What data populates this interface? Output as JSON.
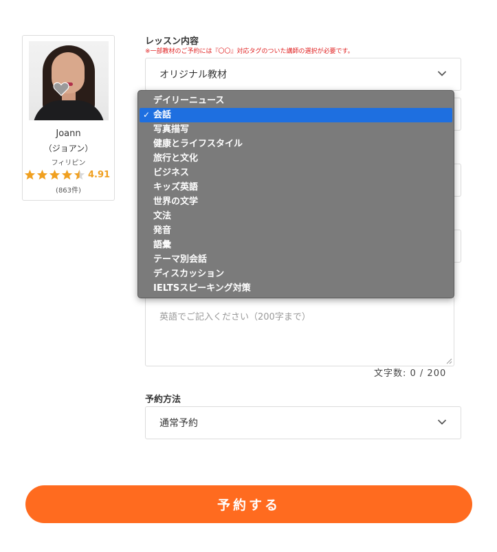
{
  "tutor": {
    "name": "Joann",
    "kana": "（ジョアン）",
    "country": "フィリピン",
    "rating": "4.91",
    "stars": 4.5,
    "reviews": "(863件)"
  },
  "lesson": {
    "label": "レッスン内容",
    "note": "※一部教材のご予約には『〇〇』対応タグのついた講師の選択が必要です。",
    "selected": "オリジナル教材"
  },
  "dropdown": {
    "options": [
      "デイリーニュース",
      "会話",
      "写真描写",
      "健康とライフスタイル",
      "旅行と文化",
      "ビジネス",
      "キッズ英語",
      "世界の文学",
      "文法",
      "発音",
      "語彙",
      "テーマ別会話",
      "ディスカッション",
      "IELTSスピーキング対策"
    ],
    "selected_index": 1,
    "check_mark": "✓"
  },
  "comment": {
    "placeholder": "英語でご記入ください（200字まで）",
    "counter": "文字数: 0 / 200"
  },
  "method": {
    "label": "予約方法",
    "selected": "通常予約"
  },
  "submit_label": "予約する",
  "colors": {
    "accent": "#ff6b1f",
    "star": "#f0a020",
    "note": "#e02020",
    "highlight": "#1e6fe0"
  }
}
